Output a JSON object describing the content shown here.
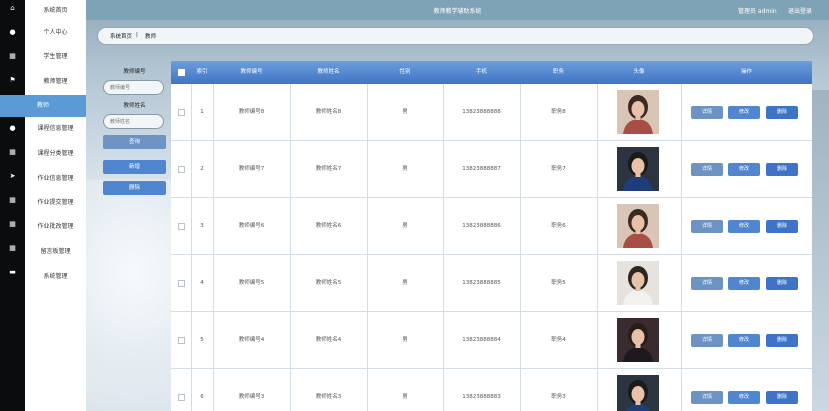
{
  "app": {
    "title": "教师教学辅助系统",
    "user": "管理员 admin",
    "logout": "退出登录"
  },
  "sidebar": {
    "items": [
      {
        "label": "系统首页",
        "icon": "home-icon"
      },
      {
        "label": "个人中心",
        "icon": "user-icon"
      },
      {
        "label": "学生管理",
        "icon": "grid-icon"
      },
      {
        "label": "教师管理",
        "icon": "flag-icon"
      },
      {
        "label": "教师",
        "icon": "",
        "active": true
      },
      {
        "label": "课程信息管理",
        "icon": "user-icon"
      },
      {
        "label": "课程分类管理",
        "icon": "grid-icon"
      },
      {
        "label": "作业信息管理",
        "icon": "send-icon"
      },
      {
        "label": "作业提交管理",
        "icon": "grid-icon"
      },
      {
        "label": "作业批改管理",
        "icon": "grid-icon"
      },
      {
        "label": "留言板管理",
        "icon": "grid-icon"
      },
      {
        "label": "系统管理",
        "icon": "monitor-icon"
      }
    ]
  },
  "breadcrumb": {
    "home": "系统首页",
    "sep": "|",
    "current": "教师"
  },
  "search": {
    "no_label": "教师编号",
    "no_placeholder": "教师编号",
    "name_label": "教师姓名",
    "name_placeholder": "教师姓名",
    "query": "查询",
    "add": "新增",
    "delete": "删除"
  },
  "table": {
    "headers": [
      "索引",
      "教师编号",
      "教师姓名",
      "性别",
      "手机",
      "职务",
      "头像",
      "操作"
    ],
    "actions": {
      "detail": "详情",
      "edit": "修改",
      "delete": "删除"
    },
    "rows": [
      {
        "index": "1",
        "no": "教师编号8",
        "name": "教师姓名8",
        "gender": "男",
        "phone": "13823888888",
        "title": "职务8",
        "avatar": "woman"
      },
      {
        "index": "2",
        "no": "教师编号7",
        "name": "教师姓名7",
        "gender": "男",
        "phone": "13823888887",
        "title": "职务7",
        "avatar": "man"
      },
      {
        "index": "3",
        "no": "教师编号6",
        "name": "教师姓名6",
        "gender": "男",
        "phone": "13823888886",
        "title": "职务6",
        "avatar": "woman"
      },
      {
        "index": "4",
        "no": "教师编号5",
        "name": "教师姓名5",
        "gender": "男",
        "phone": "13823888885",
        "title": "职务5",
        "avatar": "woman-white"
      },
      {
        "index": "5",
        "no": "教师编号4",
        "name": "教师姓名4",
        "gender": "男",
        "phone": "13823888884",
        "title": "职务4",
        "avatar": "woman-dark"
      },
      {
        "index": "6",
        "no": "教师编号3",
        "name": "教师姓名3",
        "gender": "男",
        "phone": "13823888883",
        "title": "职务3",
        "avatar": "man"
      }
    ]
  },
  "colors": {
    "primary": "#4f86cf",
    "header_bg": "#7fa3b6",
    "active_nav": "#5a9bd6"
  }
}
